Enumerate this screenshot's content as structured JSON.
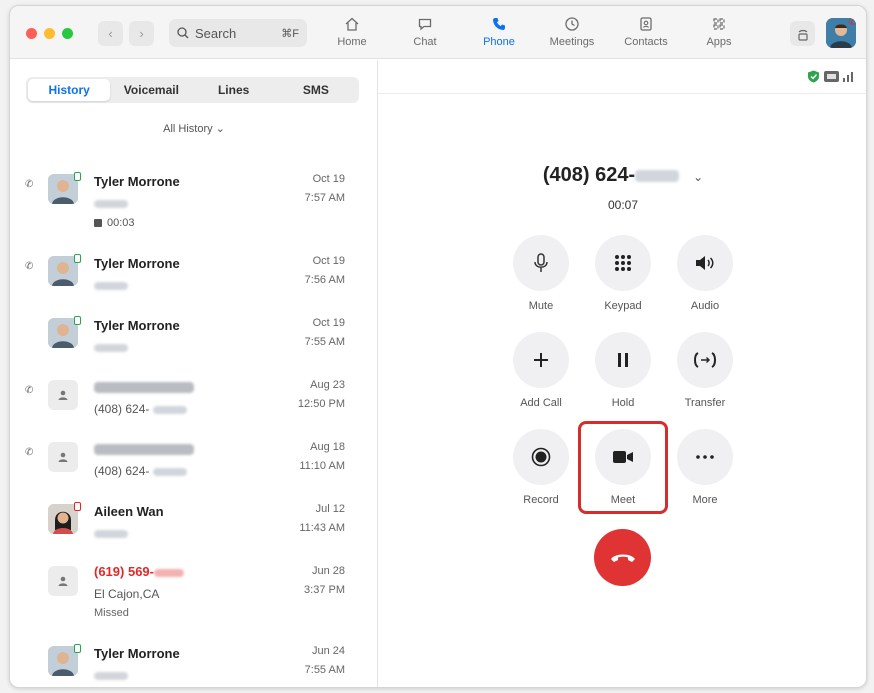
{
  "nav": {
    "search_placeholder": "Search",
    "search_shortcut": "⌘F",
    "items": [
      {
        "label": "Home"
      },
      {
        "label": "Chat"
      },
      {
        "label": "Phone"
      },
      {
        "label": "Meetings"
      },
      {
        "label": "Contacts"
      },
      {
        "label": "Apps"
      }
    ],
    "active": "Phone"
  },
  "tabs": [
    "History",
    "Voicemail",
    "Lines",
    "SMS"
  ],
  "active_tab": "History",
  "filter_label": "All History ⌄",
  "history": [
    {
      "name": "Tyler Morrone",
      "date": "Oct 19",
      "time": "7:57 AM",
      "voicemail": "00:03"
    },
    {
      "name": "Tyler Morrone",
      "date": "Oct 19",
      "time": "7:56 AM"
    },
    {
      "name": "Tyler Morrone",
      "date": "Oct 19",
      "time": "7:55 AM"
    },
    {
      "number": "(408) 624-",
      "date": "Aug 23",
      "time": "12:50 PM"
    },
    {
      "number": "(408) 624-",
      "date": "Aug 18",
      "time": "11:10 AM"
    },
    {
      "name": "Aileen Wan",
      "date": "Jul 12",
      "time": "11:43 AM"
    },
    {
      "name": "(619) 569-",
      "location": "El Cajon,CA",
      "status": "Missed",
      "date": "Jun 28",
      "time": "3:37 PM"
    },
    {
      "name": "Tyler Morrone",
      "date": "Jun 24",
      "time": "7:55 AM"
    }
  ],
  "call": {
    "number": "(408) 624-",
    "timer": "00:07",
    "controls": [
      {
        "label": "Mute",
        "icon": "microphone-icon"
      },
      {
        "label": "Keypad",
        "icon": "keypad-icon"
      },
      {
        "label": "Audio",
        "icon": "speaker-icon"
      },
      {
        "label": "Add Call",
        "icon": "plus-icon"
      },
      {
        "label": "Hold",
        "icon": "pause-icon"
      },
      {
        "label": "Transfer",
        "icon": "transfer-icon"
      },
      {
        "label": "Record",
        "icon": "record-icon"
      },
      {
        "label": "Meet",
        "icon": "video-camera-icon"
      },
      {
        "label": "More",
        "icon": "ellipsis-icon"
      }
    ]
  },
  "colors": {
    "accent": "#0e72ed",
    "end_call": "#e03434",
    "highlight": "#d62c2c",
    "missed": "#e02828"
  }
}
